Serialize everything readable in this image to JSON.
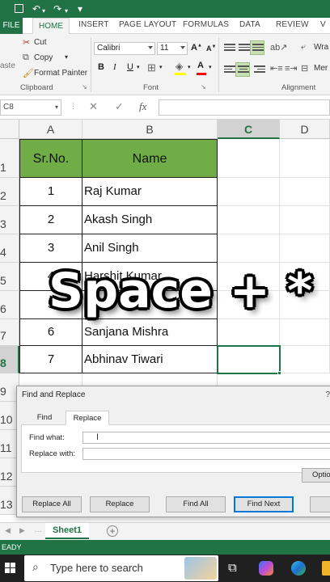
{
  "ribbon_tabs": {
    "file": "FILE",
    "home": "HOME",
    "insert": "INSERT",
    "page_layout": "PAGE LAYOUT",
    "formulas": "FORMULAS",
    "data": "DATA",
    "review": "REVIEW",
    "view_partial": "V"
  },
  "clipboard": {
    "paste_partial": "aste",
    "cut": "Cut",
    "copy": "Copy",
    "format_painter": "Format Painter",
    "group_label": "Clipboard"
  },
  "font": {
    "name": "Calibri",
    "size": "11",
    "group_label": "Font",
    "bold": "B",
    "italic": "I",
    "underline": "U"
  },
  "alignment": {
    "group_label": "Alignment",
    "wrap_partial": "Wra",
    "merge_partial": "Mer"
  },
  "formula_bar": {
    "name_box": "C8",
    "fx": "fx"
  },
  "columns": [
    "A",
    "B",
    "C",
    "D"
  ],
  "rows": [
    "1",
    "2",
    "3",
    "4",
    "5",
    "6",
    "7",
    "8",
    "9",
    "10",
    "11",
    "12",
    "13"
  ],
  "table": {
    "header_srno": "Sr.No.",
    "header_name": "Name",
    "header_color": "#70ad47",
    "records": [
      {
        "sr": "1",
        "name": "Raj Kumar"
      },
      {
        "sr": "2",
        "name": "Akash Singh"
      },
      {
        "sr": "3",
        "name": "Anil Singh"
      },
      {
        "sr": "4",
        "name": "Harshit Kumar"
      },
      {
        "sr": "5",
        "name": ""
      },
      {
        "sr": "6",
        "name": "Sanjana Mishra"
      },
      {
        "sr": "7",
        "name": "Abhinav Tiwari"
      }
    ]
  },
  "overlay_caption": "Space + *",
  "dialog": {
    "title": "Find and Replace",
    "help": "?",
    "tab_find": "Find",
    "tab_replace": "Replace",
    "find_what_label": "Find what:",
    "find_what_value": "",
    "replace_with_label": "Replace with:",
    "replace_with_value": "",
    "options_button": "Optio",
    "replace_all_button": "Replace All",
    "replace_button": "Replace",
    "find_all_button": "Find All",
    "find_next_button": "Find Next"
  },
  "sheet_tab": "Sheet1",
  "status_text": "EADY",
  "taskbar": {
    "search_placeholder": "Type here to search"
  },
  "colors": {
    "excel_green": "#217346",
    "accent_blue": "#0078d7"
  }
}
